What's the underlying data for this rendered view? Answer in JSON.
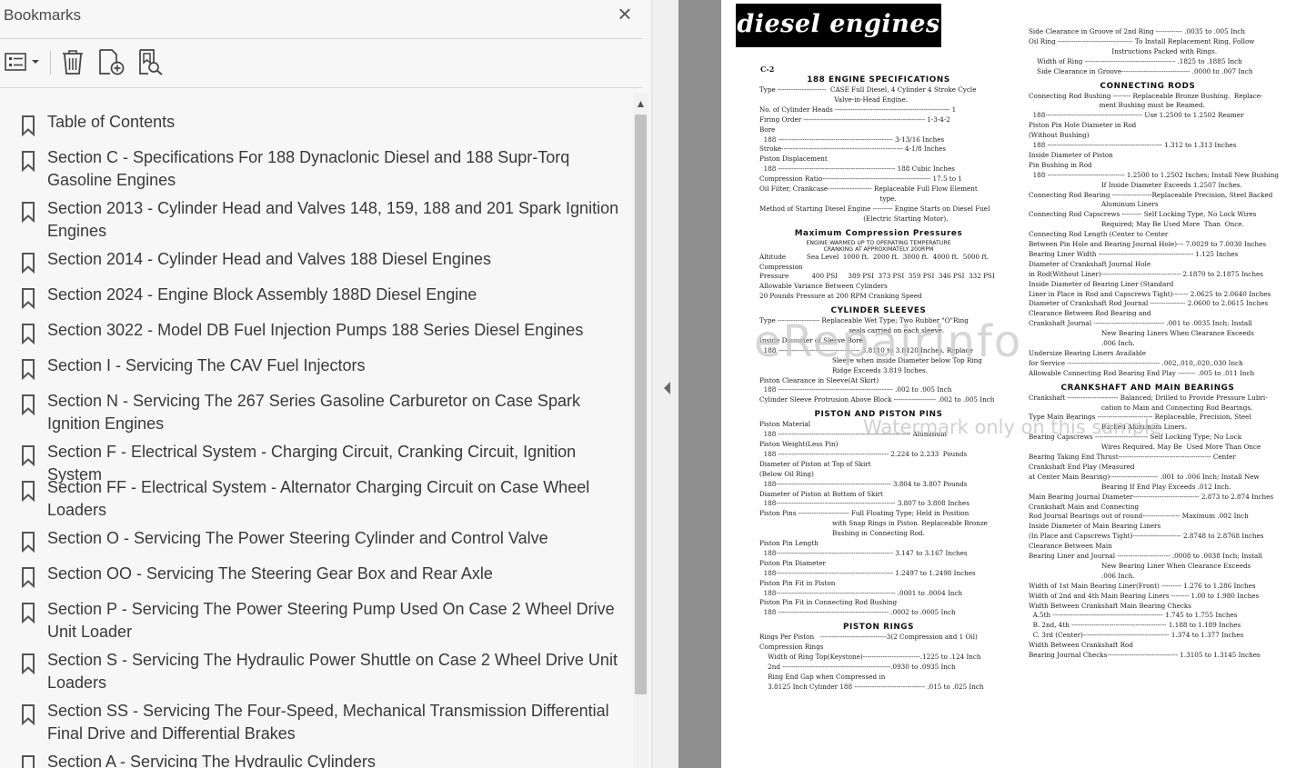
{
  "bookmarks": {
    "title": "Bookmarks",
    "close_glyph": "×",
    "toolbar": {
      "options_icon": "list-options-icon",
      "delete_icon": "trash-icon",
      "new_icon": "add-bookmark-icon",
      "find_icon": "find-current-bookmark-icon"
    },
    "items": [
      {
        "label": "Table of Contents"
      },
      {
        "label": "Section C - Specifications For 188 Dynaclonic Diesel and 188 Supr-Torq Gasoline Engines"
      },
      {
        "label": "Section 2013 - Cylinder Head and Valves 148, 159, 188 and 201 Spark Ignition Engines"
      },
      {
        "label": "Section 2014 - Cylinder Head and Valves 188 Diesel Engines"
      },
      {
        "label": "Section 2024 - Engine Block Assembly 188D Diesel Engine"
      },
      {
        "label": "Section 3022 - Model DB Fuel Injection Pumps 188 Series Diesel Engines"
      },
      {
        "label": "Section I - Servicing The CAV Fuel Injectors"
      },
      {
        "label": "Section N - Servicing The 267 Series Gasoline Carburetor on Case Spark Ignition Engines"
      },
      {
        "label": "Section F - Electrical System - Charging Circuit, Cranking Circuit, Ignition System"
      },
      {
        "label": "Section FF - Electrical System - Alternator Charging Circuit on Case Wheel Loaders"
      },
      {
        "label": "Section O - Servicing The Power Steering Cylinder and Control Valve"
      },
      {
        "label": "Section OO - Servicing The Steering Gear Box and Rear Axle"
      },
      {
        "label": "Section P - Servicing The Power Steering Pump Used On Case 2 Wheel Drive Unit Loader"
      },
      {
        "label": "Section S - Servicing The Hydraulic Power Shuttle on Case 2 Wheel Drive Unit Loaders"
      },
      {
        "label": "Section SS - Servicing The Four-Speed, Mechanical Transmission Differential Final Drive and Differential Brakes"
      },
      {
        "label": "Section A - Servicing The Hydraulic Cylinders"
      }
    ]
  },
  "document": {
    "header": "diesel engines",
    "page_code": "C-2",
    "watermark": "eRepairinfo",
    "watermark_sub": "Watermark only on this sample",
    "left_col": [
      {
        "t": "h",
        "text": "188 ENGINE SPECIFICATIONS"
      },
      {
        "t": "l",
        "text": "Type ----------------------  CASE Full Diesel, 4 Cylinder 4 Stroke Cycle"
      },
      {
        "t": "l",
        "text": "                                    Valve-in-Head Engine."
      },
      {
        "t": "l",
        "text": "No. of Cylinder Heads ---------------------------------------------------- 1"
      },
      {
        "t": "l",
        "text": "Firing Order ------------------------------------------------------- 1-3-4-2"
      },
      {
        "t": "l",
        "text": "Bore"
      },
      {
        "t": "l",
        "text": "  188 ---------------------------------------------------- 3-13/16 Inches"
      },
      {
        "t": "l",
        "text": "Stroke------------------------------------------------------- 4-1/8 Inches"
      },
      {
        "t": "l",
        "text": "Piston Displacement"
      },
      {
        "t": "l",
        "text": "  188 ----------------------------------------------------- 188 Cubic Inches"
      },
      {
        "t": "l",
        "text": "Compression Ratio------------------------------------------------- 17.5 to 1"
      },
      {
        "t": "l",
        "text": "Oil Filter, Crankcase-------------------- Replaceable Full Flow Element"
      },
      {
        "t": "l",
        "text": "                                                          type."
      },
      {
        "t": "l",
        "text": "Method of Starting Diesel Engine --------- Engine Starts on Diesel Fuel"
      },
      {
        "t": "l",
        "text": "                                                  (Electric Starting Motor)."
      },
      {
        "t": "h",
        "text": "Maximum Compression Pressures"
      },
      {
        "t": "s",
        "text": "ENGINE WARMED UP TO OPERATING TEMPERATURE"
      },
      {
        "t": "s",
        "text": "CRANKING AT APPROXIMATELY 200RPM"
      },
      {
        "t": "l",
        "text": "Altitude          Sea Level  1000 ft.  2000 ft.  3000 ft.  4000 ft.  5000 ft."
      },
      {
        "t": "l",
        "text": "Compression"
      },
      {
        "t": "l",
        "text": "Pressure           400 PSI     389 PSI  373 PSI  359 PSI  346 PSI  332 PSI"
      },
      {
        "t": "l",
        "text": "Allowable Variance Between Cylinders"
      },
      {
        "t": "l",
        "text": "20 Pounds Pressure at 200 RPM Cranking Speed"
      },
      {
        "t": "h",
        "text": "CYLINDER SLEEVES"
      },
      {
        "t": "l",
        "text": "Type ------------------- Replaceable Wet Type; Two Rubber \"O\"Ring"
      },
      {
        "t": "l",
        "text": "                                           seals carried on each sleeve."
      },
      {
        "t": "l",
        "text": "Inside Diameter of Sleeve Bore"
      },
      {
        "t": "l",
        "text": "  188 ------------------------------------- 3.8110 to 3.8120 Inches, Replace"
      },
      {
        "t": "l",
        "text": "                                   Sleeve when inside Diameter below Top Ring"
      },
      {
        "t": "l",
        "text": "                                   Ridge Exceeds 3.819 Inches."
      },
      {
        "t": "l",
        "text": "Piston Clearance in Sleeve(At Skirt)"
      },
      {
        "t": "l",
        "text": "  188 ---------------------------------------------------- .002 to .005 Inch"
      },
      {
        "t": "l",
        "text": "Cylinder Sleeve Protrusion Above Block ------------------- .002 to .005 Inch"
      },
      {
        "t": "h",
        "text": "PISTON AND PISTON PINS"
      },
      {
        "t": "l",
        "text": "Piston Material"
      },
      {
        "t": "l",
        "text": "  188 ------------------------------------------------------------ Aluminum"
      },
      {
        "t": "l",
        "text": "Piston Weight(Less Pin)"
      },
      {
        "t": "l",
        "text": "  188 -------------------------------------------------- 2.224 to 2.233  Pounds"
      },
      {
        "t": "l",
        "text": "Diameter of Piston at Top of Skirt"
      },
      {
        "t": "l",
        "text": "(Below Oil Ring)"
      },
      {
        "t": "l",
        "text": "  188---------------------------------------------------- 3.804 to 3.807 Pounds"
      },
      {
        "t": "l",
        "text": "Diameter of Piston at Bottom of Skirt"
      },
      {
        "t": "l",
        "text": "  188------------------------------------------------------ 3.807 to 3.808 Inches"
      },
      {
        "t": "l",
        "text": "Piston Pins ----------------------- Full Floating Type; Held in Position"
      },
      {
        "t": "l",
        "text": "                                   with Snap Rings in Piston. Replaceable Bronze"
      },
      {
        "t": "l",
        "text": "                                   Bushing in Connecting Rod."
      },
      {
        "t": "l",
        "text": "Piston Pin Length"
      },
      {
        "t": "l",
        "text": "  188----------------------------------------------------- 3.147 to 3.167 Inches"
      },
      {
        "t": "l",
        "text": "Piston Pin Diameter"
      },
      {
        "t": "l",
        "text": "  188----------------------------------------------------- 1.2497 to 1.2498 Inches"
      },
      {
        "t": "l",
        "text": "Piston Pin Fit in Piston"
      },
      {
        "t": "l",
        "text": "  188------------------------------------------------------ .0001 to .0004 Inch"
      },
      {
        "t": "l",
        "text": "Piston Pin Fit in Connecting Rod Bushing"
      },
      {
        "t": "l",
        "text": "  188 -------------------------------------------------- .0002 to .0005 Inch"
      },
      {
        "t": "h",
        "text": "PISTON RINGS"
      },
      {
        "t": "l",
        "text": "Rings Per Piston   ------------------------------3(2 Compression and 1 Oil)"
      },
      {
        "t": "l",
        "text": "Compression Rings"
      },
      {
        "t": "l",
        "text": "    Width of Ring Top(Keystone)--------------------------.1225 to .124 Inch"
      },
      {
        "t": "l",
        "text": "    2nd -------------------------------------------------.0930 to .0935 Inch"
      },
      {
        "t": "l",
        "text": "    Ring End Gap when Compressed in"
      },
      {
        "t": "l",
        "text": "    3.8125 Inch Cylinder 188 -------------------------------- .015 to .025 Inch"
      }
    ],
    "right_col": [
      {
        "t": "l",
        "text": "Side Clearance in Groove of 2nd Ring ------------ .0035 to .005 Inch"
      },
      {
        "t": "l",
        "text": "Oil Ring ---------------------------------- To Install Replacement Ring, Follow"
      },
      {
        "t": "l",
        "text": "                                        Instructions Packed with Rings."
      },
      {
        "t": "l",
        "text": "    Width of Ring ----------------------------------------- .1825 to .1885 Inch"
      },
      {
        "t": "l",
        "text": "    Side Clearance in Groove------------------------------- .0000 to .007 Inch"
      },
      {
        "t": "h",
        "text": "CONNECTING RODS"
      },
      {
        "t": "l",
        "text": "Connecting Rod Bushing -------- Replaceable Bronze Bushing.  Replace-"
      },
      {
        "t": "l",
        "text": "                                  ment Bushing must be Reamed."
      },
      {
        "t": "l",
        "text": "  188-------------------------------------------- Use 1.2500 to 1.2502 Reamer"
      },
      {
        "t": "l",
        "text": "Piston Pin Hole Diameter in Rod"
      },
      {
        "t": "l",
        "text": "(Without Bushing)"
      },
      {
        "t": "l",
        "text": "  188 ---------------------------------------------------- 1.312 to 1.313 Inches"
      },
      {
        "t": "l",
        "text": "Inside Diameter of Piston"
      },
      {
        "t": "l",
        "text": "Pin Bushing in Rod"
      },
      {
        "t": "l",
        "text": "  188 ----------------------------------- 1.2500 to 1.2502 Inches; Install New Bushing"
      },
      {
        "t": "l",
        "text": "                                   If Inside Diameter Exceeds 1.2507 Inches."
      },
      {
        "t": "l",
        "text": "Connecting Rod Bearing ------------------Replaceable Precision, Steel Backed"
      },
      {
        "t": "l",
        "text": "                                   Aluminum Liners"
      },
      {
        "t": "l",
        "text": "Connecting Rod Capscrews --------- Self Locking Type, No Lock Wires"
      },
      {
        "t": "l",
        "text": "                                   Required; May Be Used More  Than  Once."
      },
      {
        "t": "l",
        "text": "Connecting Rod Length (Center to Center"
      },
      {
        "t": "l",
        "text": "Between Pin Hole and Bearing Journal Hole)--- 7.0029 to 7.0030 Inches"
      },
      {
        "t": "l",
        "text": "Bearing Liner Width ------------------------------------------- 1.125 Inches"
      },
      {
        "t": "l",
        "text": "Diameter of Crankshaft Journal Hole"
      },
      {
        "t": "l",
        "text": "in Rod(Without Liner)------------------------------------ 2.1870 to 2.1875 Inches"
      },
      {
        "t": "l",
        "text": "Inside Diameter of Bearing Liner (Standard"
      },
      {
        "t": "l",
        "text": "Liner in Place in Rod and Capscrews Tight)------- 2.0625 to 2.0640 Inches"
      },
      {
        "t": "l",
        "text": "Diameter of Crankshaft Rod Journal ---------------- 2.0600 to 2.0615 Inches"
      },
      {
        "t": "l",
        "text": "Clearance Between Rod Bearing and"
      },
      {
        "t": "l",
        "text": "Crankshaft Journal -------------------------------- .001 to .0035 Inch; Install"
      },
      {
        "t": "l",
        "text": "                                   New Bearing Liners When Clearance Exceeds"
      },
      {
        "t": "l",
        "text": "                                   .006 Inch."
      },
      {
        "t": "l",
        "text": "Undersize Bearing Liners Available"
      },
      {
        "t": "l",
        "text": "for Service ------------------------------------------ .002,.010,.020,.030 Inch"
      },
      {
        "t": "l",
        "text": "Allowable Connecting Rod Bearing End Play -------- .005 to .011 Inch"
      },
      {
        "t": "h",
        "text": "CRANKSHAFT AND MAIN BEARINGS"
      },
      {
        "t": "l",
        "text": "Crankshaft ----------------------- Balanced; Drilled to Provide Pressure Lubri-"
      },
      {
        "t": "l",
        "text": "                                   cation to Main and Connecting Rod Bearings."
      },
      {
        "t": "l",
        "text": "Type Main Bearings ------------------------- Replaceable, Precision, Steel"
      },
      {
        "t": "l",
        "text": "                                   Backed Aluminum Liners."
      },
      {
        "t": "l",
        "text": "Bearing Capscrews ------------------------ Self Locking Type; No Lock"
      },
      {
        "t": "l",
        "text": "                                   Wires Required. May Be  Used More Than Once"
      },
      {
        "t": "l",
        "text": "Bearing Taking End Thrust------------------------------------------ Center"
      },
      {
        "t": "l",
        "text": "Crankshaft End Play (Measured"
      },
      {
        "t": "l",
        "text": "at Center Main Bearing)---------------------- .001 to .006 Inch; Install New"
      },
      {
        "t": "l",
        "text": "                                   Bearing If End Play Exceeds .012 Inch."
      },
      {
        "t": "l",
        "text": "Main Bearing Journal Diameter------------------------------ 2.873 to 2.874 Inches"
      },
      {
        "t": "l",
        "text": "Crankshaft Main and Connecting"
      },
      {
        "t": "l",
        "text": "Rod Journal Bearings out of round----------------- Maximum .002 Inch"
      },
      {
        "t": "l",
        "text": "Inside Diameter of Main Bearing Liners"
      },
      {
        "t": "l",
        "text": "(In Place and Capscrews Tight)---------------------- 2.8748 to 2.8768 Inches"
      },
      {
        "t": "l",
        "text": "Clearance Between Main"
      },
      {
        "t": "l",
        "text": "Bearing Liner and Journal ------------------------ .0008 to .0038 Inch; Install"
      },
      {
        "t": "l",
        "text": "                                   New Bearing Liner When Clearance Exceeds"
      },
      {
        "t": "l",
        "text": "                                   .006 Inch."
      },
      {
        "t": "l",
        "text": "Width of 1st Main Bearing Liner(Front) --------- 1.276 to 1.286 Inches"
      },
      {
        "t": "l",
        "text": "Width of 2nd and 4th Main Bearing Liners -------- 1.00 to 1.980 Inches"
      },
      {
        "t": "l",
        "text": "Width Between Crankshaft Main Bearing Checks"
      },
      {
        "t": "l",
        "text": "  A.5th -------------------------------------------------- 1.745 to 1.755 Inches"
      },
      {
        "t": "l",
        "text": "  B. 2nd, 4th ------------------------------------------- 1.188 to 1.189 Inches"
      },
      {
        "t": "l",
        "text": "  C. 3rd (Center)--------------------------------------- 1.374 to 1.377 Inches"
      },
      {
        "t": "l",
        "text": "Width Between Crankshaft Rod"
      },
      {
        "t": "l",
        "text": "Bearing Journal Checks-------------------------------- 1.3105 to 1.3145 Inches"
      }
    ]
  }
}
